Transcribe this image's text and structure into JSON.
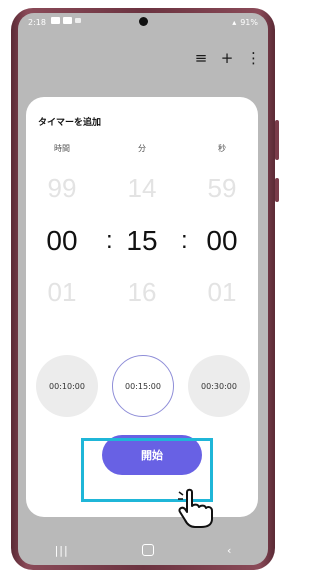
{
  "status": {
    "time": "2:18",
    "battery": "91%"
  },
  "toolbar": {
    "list_icon": "≡",
    "add_icon": "+",
    "more_icon": "⋮"
  },
  "dialog": {
    "title": "タイマーを追加",
    "columns": [
      "時間",
      "分",
      "秒"
    ],
    "picker": {
      "hours": {
        "prev": "99",
        "current": "00",
        "next": "01"
      },
      "minutes": {
        "prev": "14",
        "current": "15",
        "next": "16"
      },
      "seconds": {
        "prev": "59",
        "current": "00",
        "next": "01"
      }
    },
    "separator": ":",
    "presets": [
      "00:10:00",
      "00:15:00",
      "00:30:00"
    ],
    "selected_preset_index": 1,
    "start_label": "開始"
  },
  "colors": {
    "accent": "#6861e4",
    "highlight_box": "#1fb6d8",
    "preset_selected_border": "#8f8ed8"
  }
}
